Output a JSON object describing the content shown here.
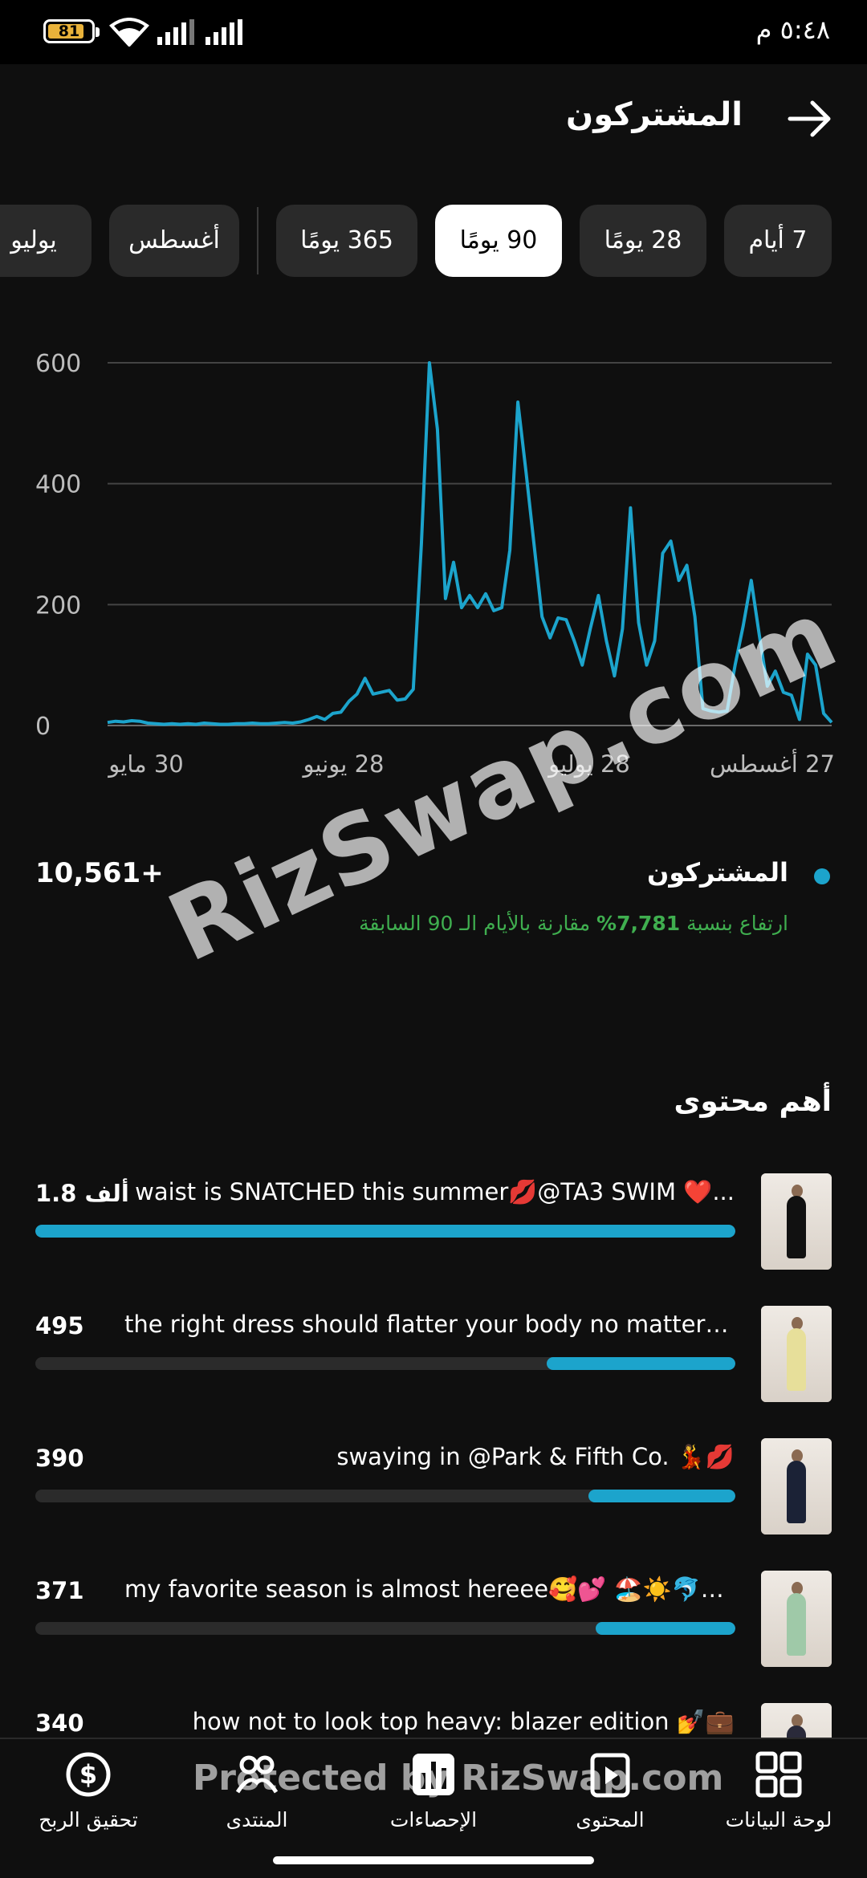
{
  "status_bar": {
    "time": "٥:٤٨ م",
    "battery_level": "81"
  },
  "header": {
    "title": "المشتركون"
  },
  "filters": [
    {
      "label": "7 أيام",
      "active": false
    },
    {
      "label": "28 يومًا",
      "active": false
    },
    {
      "label": "90 يومًا",
      "active": true
    },
    {
      "label": "365 يومًا",
      "active": false
    },
    {
      "label": "أغسطس",
      "active": false
    },
    {
      "label": "يوليو",
      "active": false
    }
  ],
  "chart_data": {
    "type": "line",
    "ylim": [
      0,
      600
    ],
    "yticks": [
      "600",
      "400",
      "200",
      "0"
    ],
    "xtick_labels": [
      "30 مايو",
      "28 يونيو",
      "28 يوليو",
      "27 أغسطس"
    ],
    "series": [
      {
        "color": "#1ca4cc",
        "values": [
          5,
          7,
          6,
          8,
          7,
          4,
          3,
          2,
          3,
          2,
          3,
          2,
          4,
          3,
          2,
          2,
          3,
          3,
          4,
          3,
          3,
          4,
          5,
          4,
          6,
          10,
          15,
          10,
          20,
          22,
          40,
          52,
          78,
          52,
          55,
          58,
          42,
          44,
          60,
          300,
          600,
          490,
          210,
          270,
          195,
          215,
          195,
          218,
          190,
          195,
          290,
          535,
          420,
          300,
          180,
          145,
          178,
          175,
          140,
          100,
          160,
          215,
          140,
          82,
          160,
          360,
          170,
          100,
          140,
          285,
          305,
          240,
          265,
          180,
          28,
          24,
          22,
          24,
          100,
          165,
          240,
          150,
          65,
          90,
          55,
          50,
          10,
          118,
          100,
          20,
          5
        ]
      }
    ]
  },
  "legend": {
    "label": "المشتركون",
    "value": "10,561+",
    "growth_prefix": "ارتفاع بنسبة",
    "growth_percent": "7,781%",
    "growth_suffix": "مقارنة بالأيام الـ 90 السابقة"
  },
  "watermark": {
    "text": "RizSwap.com",
    "nav_text": "Protected by RizSwap.com"
  },
  "top_content": {
    "title": "أهم محتوى",
    "items": [
      {
        "title": "waist is SNATCHED this summer💋@TA3 SWIM ❤️...",
        "value": "1.8 ألف",
        "fraction": 1.0,
        "outfit_color": "#111111"
      },
      {
        "title": "the right dress should flatter your body no matter dani...",
        "value": "495",
        "fraction": 0.27,
        "outfit_color": "#e7df9a"
      },
      {
        "title": "swaying in @Park & Fifth Co. 💃💋",
        "value": "390",
        "fraction": 0.21,
        "outfit_color": "#1b2236"
      },
      {
        "title": "my favorite season is almost hereee🥰💕 🏖️☀️🐬✨...",
        "value": "371",
        "fraction": 0.2,
        "outfit_color": "#9fc9a8"
      },
      {
        "title": "how not to look top heavy: blazer edition 💅💼",
        "value": "340",
        "fraction": 0.18,
        "outfit_color": "#2a2a3a"
      }
    ]
  },
  "bottom_nav": [
    {
      "label": "لوحة البيانات",
      "icon": "dashboard-icon"
    },
    {
      "label": "المحتوى",
      "icon": "content-icon"
    },
    {
      "label": "الإحصاءات",
      "icon": "analytics-icon"
    },
    {
      "label": "المنتدى",
      "icon": "community-icon"
    },
    {
      "label": "تحقيق الربح",
      "icon": "monetization-icon"
    }
  ]
}
